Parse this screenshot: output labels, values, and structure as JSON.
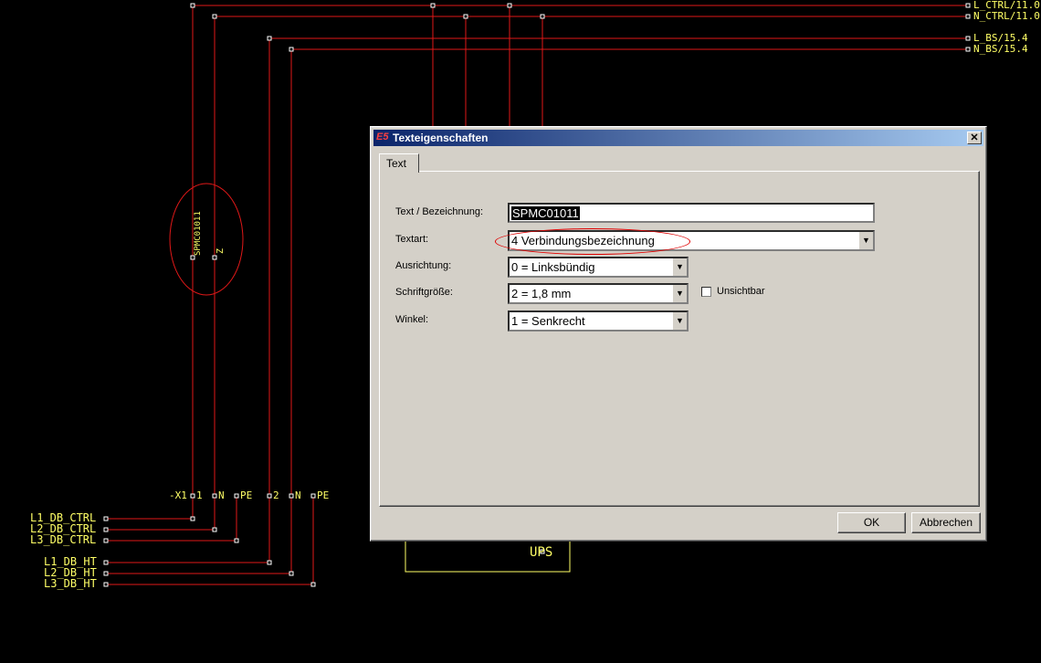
{
  "schematic": {
    "right_refs": [
      "L_CTRL/11.0",
      "N_CTRL/11.0",
      "L_BS/15.4",
      "N_BS/15.4"
    ],
    "left_refs": [
      "L1_DB_CTRL",
      "L2_DB_CTRL",
      "L3_DB_CTRL",
      "L1_DB_HT",
      "L2_DB_HT",
      "L3_DB_HT"
    ],
    "terminal_labels": [
      "-X1",
      "1",
      "N",
      "PE",
      "2",
      "N",
      "PE"
    ],
    "vertical_label": "SPMC01011",
    "vertical_label_2": "Z",
    "device_label": "UPS",
    "wire_color": "#e01818",
    "text_color": "#ffff66"
  },
  "dialog": {
    "title": "Texteigenschaften",
    "close_glyph": "✕",
    "tab": "Text",
    "fields": {
      "text_label": "Text / Bezeichnung:",
      "text_value": "SPMC01011",
      "textart_label": "Textart:",
      "textart_value": "4 Verbindungsbezeichnung",
      "ausrichtung_label": "Ausrichtung:",
      "ausrichtung_value": "0 = Linksbündig",
      "schrift_label": "Schriftgröße:",
      "schrift_value": "2 = 1,8 mm",
      "unsichtbar_label": "Unsichtbar",
      "winkel_label": "Winkel:",
      "winkel_value": "1 = Senkrecht"
    },
    "ok_label": "OK",
    "cancel_label": "Abbrechen"
  }
}
